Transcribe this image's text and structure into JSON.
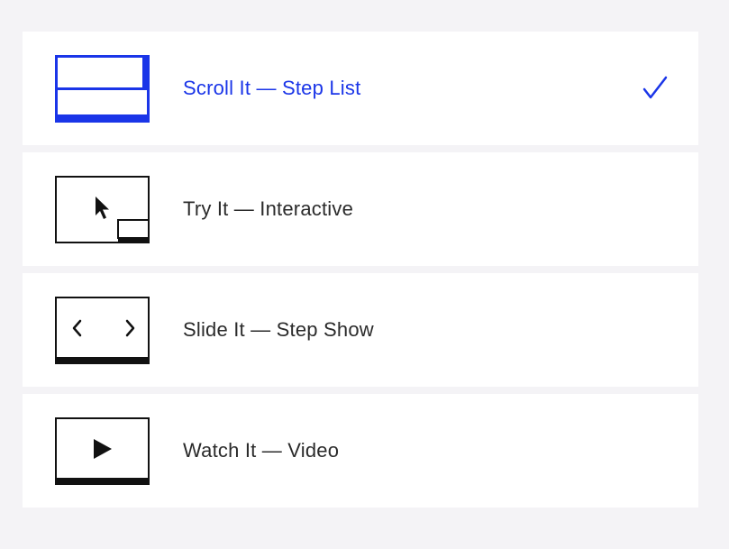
{
  "colors": {
    "accent": "#1a35e8",
    "text": "#2b2b2b",
    "background": "#f4f3f6",
    "card": "#ffffff"
  },
  "options": [
    {
      "label": "Scroll It — Step List",
      "icon": "scroll-step-list-icon",
      "selected": true
    },
    {
      "label": "Try It — Interactive",
      "icon": "interactive-cursor-icon",
      "selected": false
    },
    {
      "label": "Slide It — Step Show",
      "icon": "slide-arrows-icon",
      "selected": false
    },
    {
      "label": "Watch It — Video",
      "icon": "video-play-icon",
      "selected": false
    }
  ],
  "selected_indicator": "checkmark-icon"
}
